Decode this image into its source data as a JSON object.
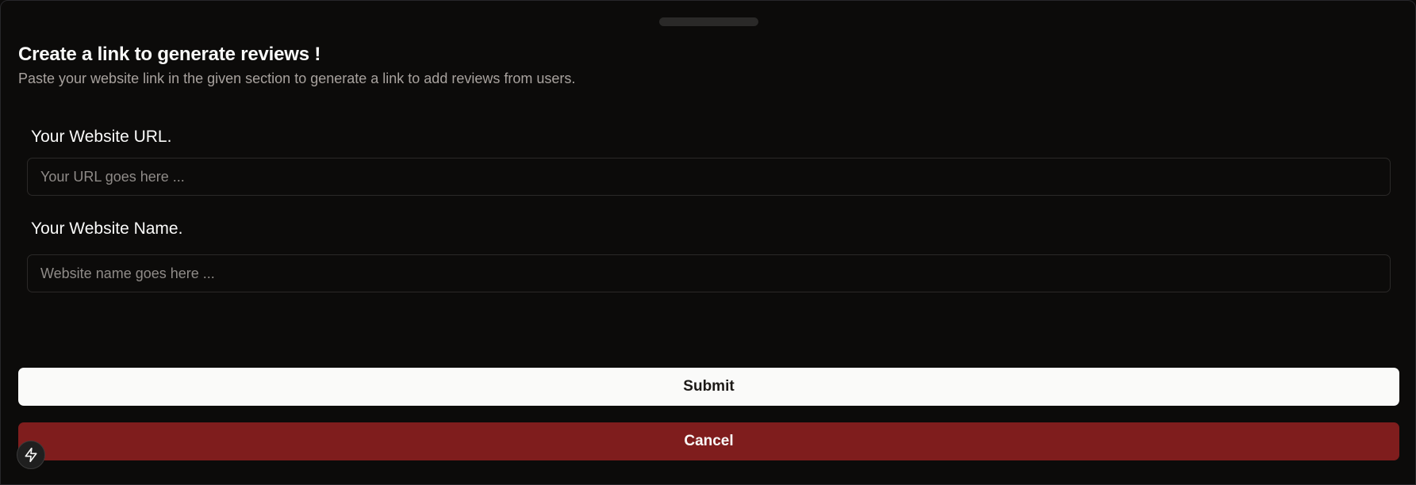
{
  "drawer": {
    "title": "Create a link to generate reviews !",
    "description": "Paste your website link in the given section to generate a link to add reviews from users."
  },
  "form": {
    "url_label": "Your Website URL.",
    "url_placeholder": "Your URL goes here ...",
    "url_value": "",
    "name_label": "Your Website Name.",
    "name_placeholder": "Website name goes here ...",
    "name_value": ""
  },
  "actions": {
    "submit_label": "Submit",
    "cancel_label": "Cancel"
  },
  "icons": {
    "fab": "lightning-bolt-icon",
    "handle": "drawer-handle"
  },
  "colors": {
    "background": "#0c0b0a",
    "submit_bg": "#fafaf9",
    "cancel_bg": "#7f1d1d"
  }
}
